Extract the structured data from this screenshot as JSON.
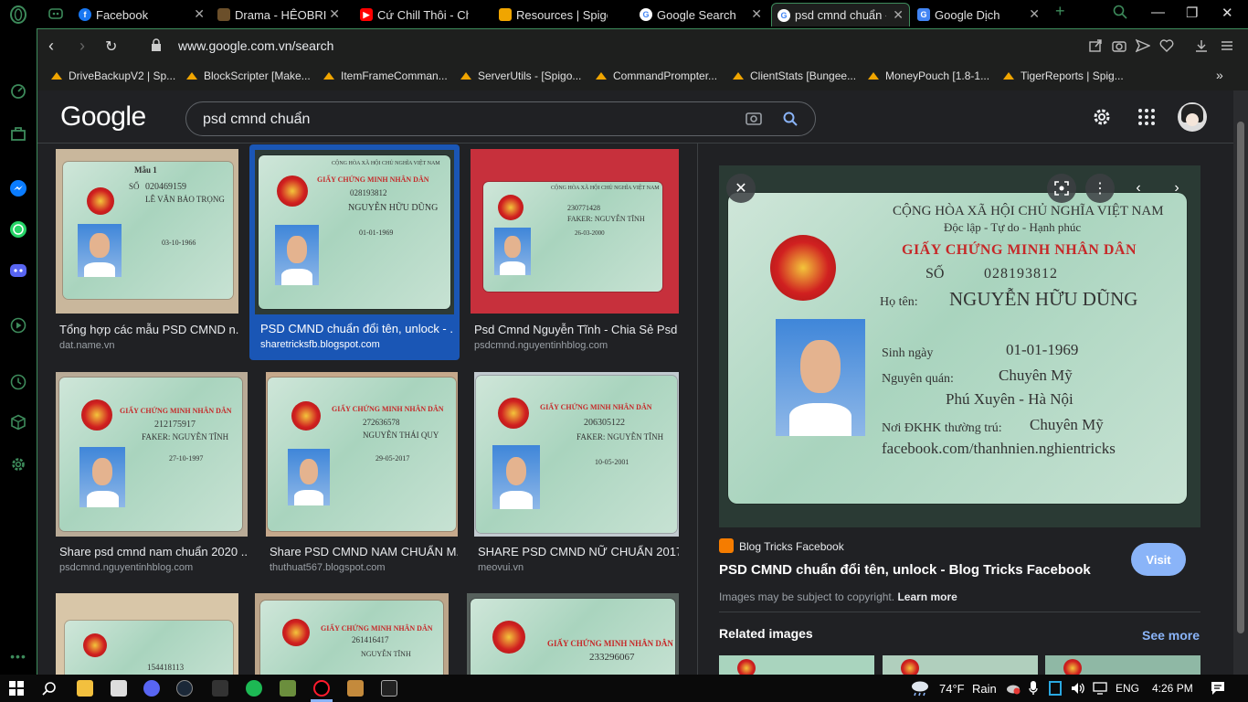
{
  "browser": {
    "tabs": [
      {
        "title": "Facebook",
        "favicon_color": "#1877f2",
        "active": false
      },
      {
        "title": "Drama - HÊOBRINE",
        "favicon_color": "#6b4f2a",
        "active": false
      },
      {
        "title": "Cứ Chill Thôi - Chil",
        "favicon_color": "#ff0000",
        "active": false
      },
      {
        "title": "Resources | Spigot",
        "favicon_color": "#f0a500",
        "active": false
      },
      {
        "title": "Google Search",
        "favicon_color": "#4285f4",
        "active": false
      },
      {
        "title": "psd cmnd chuẩn -",
        "favicon_color": "#4285f4",
        "active": true
      },
      {
        "title": "Google Dịch",
        "favicon_color": "#4285f4",
        "active": false
      }
    ],
    "url": "www.google.com.vn/search",
    "bookmarks": [
      "DriveBackupV2 | Sp...",
      "BlockScripter [Make...",
      "ItemFrameComman...",
      "ServerUtils - [Spigo...",
      "CommandPrompter...",
      "ClientStats [Bungee...",
      "MoneyPouch [1.8-1...",
      "TigerReports | Spig..."
    ],
    "accent_color": "#3d8b5b"
  },
  "google": {
    "logo": "Google",
    "query": "psd cmnd chuẩn"
  },
  "results": [
    {
      "title": "Tổng hợp các mẫu PSD CMND n...",
      "source": "dat.name.vn",
      "card": {
        "number": "020469159",
        "name": "LÊ VĂN BẢO TRỌNG",
        "dob": "03-10-1966",
        "label": "Mẫu 1"
      }
    },
    {
      "title": "PSD CMND chuẩn đổi tên, unlock - ...",
      "source": "sharetricksfb.blogspot.com",
      "card": {
        "number": "028193812",
        "name": "NGUYỄN HỮU DŨNG",
        "dob": "01-01-1969"
      }
    },
    {
      "title": "Psd Cmnd Nguyễn Tĩnh - Chia Sẻ Psd ...",
      "source": "psdcmnd.nguyentinhblog.com",
      "card": {
        "number": "230771428",
        "name": "FAKER: NGUYỄN TĨNH",
        "dob": "26-03-2000"
      }
    },
    {
      "title": "Share psd cmnd nam chuẩn 2020 ...",
      "source": "psdcmnd.nguyentinhblog.com",
      "card": {
        "number": "212175917",
        "name": "FAKER: NGUYỄN TĨNH",
        "dob": "27-10-1997"
      }
    },
    {
      "title": "Share PSD CMND NAM CHUẨN M...",
      "source": "thuthuat567.blogspot.com",
      "card": {
        "number": "272636578",
        "name": "NGUYỄN THÁI QUY",
        "dob": "29-05-2017"
      }
    },
    {
      "title": "SHARE PSD CMND NỮ CHUẨN 2017 ...",
      "source": "meovui.vn",
      "card": {
        "number": "206305122",
        "name": "FAKER: NGUYỄN TĨNH",
        "dob": "10-05-2001"
      }
    },
    {
      "title": "",
      "source": "",
      "card": {
        "number": "154418113",
        "name": "",
        "dob": ""
      }
    },
    {
      "title": "",
      "source": "",
      "card": {
        "number": "261416417",
        "name": "NGUYỄN TĨNH",
        "dob": ""
      }
    },
    {
      "title": "",
      "source": "",
      "card": {
        "number": "233296067",
        "name": "",
        "dob": ""
      }
    }
  ],
  "card_common": {
    "header1": "CỘNG HÒA XÃ HỘI CHỦ NGHĨA VIỆT NAM",
    "header2": "Độc lập - Tự do - Hạnh phúc",
    "title": "GIẤY CHỨNG MINH NHÂN DÂN",
    "so": "SỐ"
  },
  "preview": {
    "card": {
      "number": "028193812",
      "name_label": "Họ tên:",
      "name": "NGUYỄN HỮU DŨNG",
      "dob_label": "Sinh ngày",
      "dob": "01-01-1969",
      "origin_label": "Nguyên quán:",
      "origin": "Chuyên Mỹ",
      "origin2": "Phú Xuyên - Hà Nội",
      "residence_label": "Nơi ĐKHK thường trú:",
      "residence": "Chuyên Mỹ",
      "residence2": "facebook.com/thanhnien.nghientricks"
    },
    "site": "Blog Tricks Facebook",
    "title": "PSD CMND chuẩn đổi tên, unlock - Blog Tricks Facebook",
    "visit": "Visit",
    "copyright": "Images may be subject to copyright.",
    "learn_more": "Learn more",
    "related_heading": "Related images",
    "see_more": "See more"
  },
  "taskbar": {
    "weather_temp": "74°F",
    "weather_cond": "Rain",
    "language": "ENG",
    "time": "4:26 PM"
  }
}
